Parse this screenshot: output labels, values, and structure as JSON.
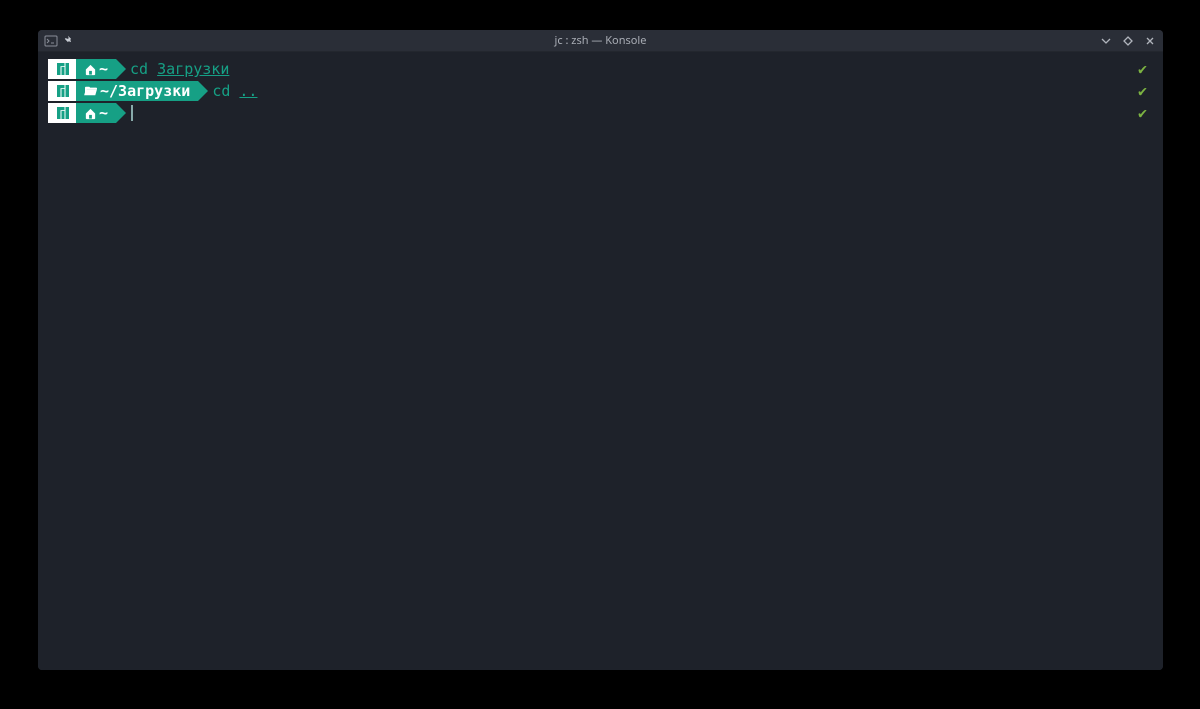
{
  "window": {
    "title": "jc : zsh — Konsole"
  },
  "colors": {
    "accent": "#16a085",
    "bg": "#1e222a",
    "ok": "#7cb342"
  },
  "prompt": {
    "tilde": "~",
    "downloads_path": "~/Загрузки"
  },
  "lines": [
    {
      "cmd": "cd",
      "arg": "Загрузки",
      "status": "ok",
      "context": "home"
    },
    {
      "cmd": "cd",
      "arg": "..",
      "status": "ok",
      "context": "downloads"
    },
    {
      "cmd": "",
      "arg": "",
      "status": "ok",
      "context": "home",
      "cursor": true
    }
  ]
}
